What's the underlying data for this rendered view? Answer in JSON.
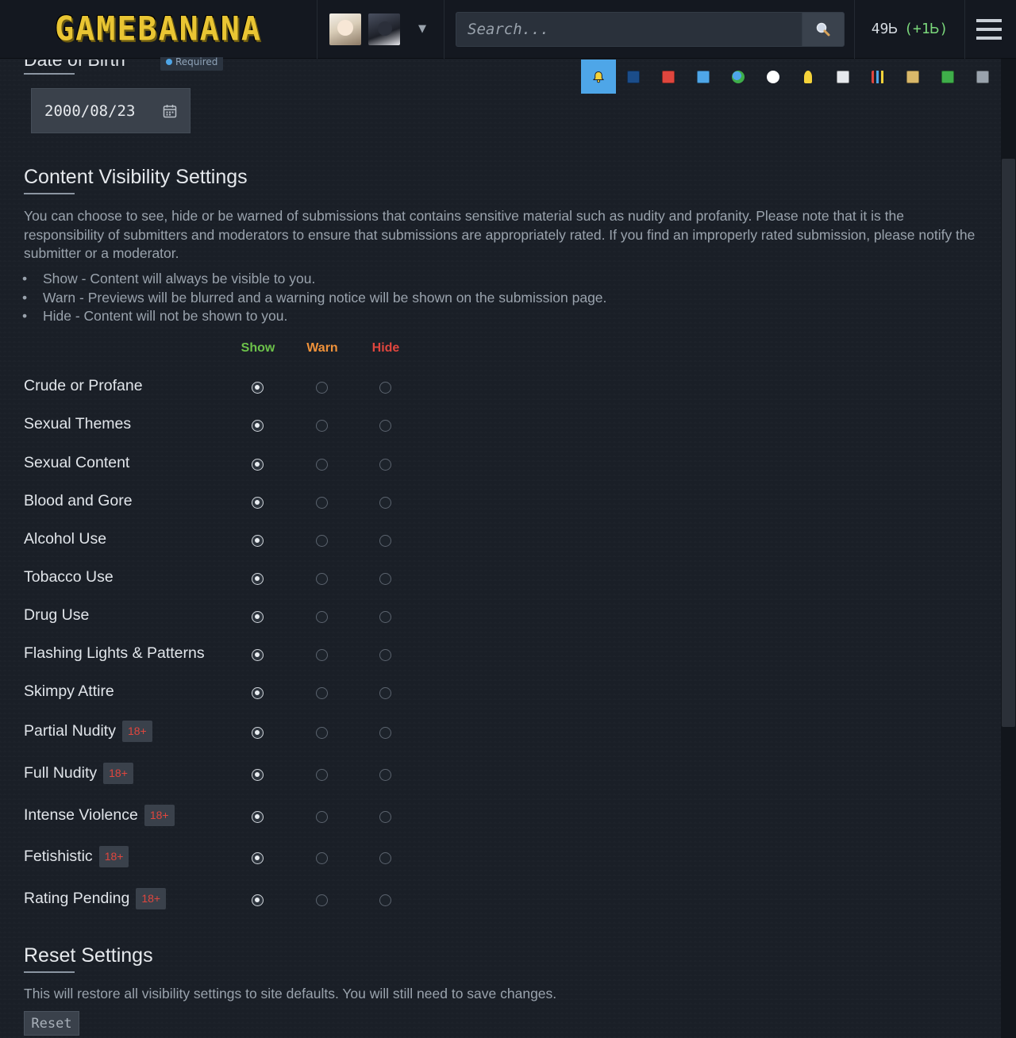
{
  "header": {
    "logo_text": "GAMEBANANA",
    "search_placeholder": "Search...",
    "points": "49Ꮟ",
    "points_delta": "(+1Ꮟ)"
  },
  "toolbar": {
    "icons": [
      "bell-icon",
      "dashboard-icon",
      "gift-icon",
      "folder-icon",
      "globe-icon",
      "dice-icon",
      "bulb-icon",
      "mail-icon",
      "stats-icon",
      "clipboard-icon",
      "inbox-icon",
      "grid-icon"
    ],
    "icon_colors": [
      "#f5d33a",
      "#1b4d8a",
      "#e0463e",
      "#4ea6e8",
      "#3fae4a",
      "#ffffff",
      "#f5d33a",
      "#e6e9ed",
      "#e0463e",
      "#d9b86a",
      "#3fae4a",
      "#9aa3ad"
    ]
  },
  "dob": {
    "title": "Date of Birth",
    "required_label": "Required",
    "value": "2000/08/23"
  },
  "visibility": {
    "title": "Content Visibility Settings",
    "description": "You can choose to see, hide or be warned of submissions that contains sensitive material such as nudity and profanity. Please note that it is the responsibility of submitters and moderators to ensure that submissions are appropriately rated. If you find an improperly rated submission, please notify the submitter or a moderator.",
    "bullets": [
      "Show - Content will always be visible to you.",
      "Warn - Previews will be blurred and a warning notice will be shown on the submission page.",
      "Hide - Content will not be shown to you."
    ],
    "columns": {
      "show": "Show",
      "warn": "Warn",
      "hide": "Hide"
    },
    "column_colors": {
      "show": "#6cc24a",
      "warn": "#f0923a",
      "hide": "#e0463e"
    },
    "badge_label": "18+",
    "rows": [
      {
        "label": "Crude or Profane",
        "badge": false,
        "selected": "show"
      },
      {
        "label": "Sexual Themes",
        "badge": false,
        "selected": "show"
      },
      {
        "label": "Sexual Content",
        "badge": false,
        "selected": "show"
      },
      {
        "label": "Blood and Gore",
        "badge": false,
        "selected": "show"
      },
      {
        "label": "Alcohol Use",
        "badge": false,
        "selected": "show"
      },
      {
        "label": "Tobacco Use",
        "badge": false,
        "selected": "show"
      },
      {
        "label": "Drug Use",
        "badge": false,
        "selected": "show"
      },
      {
        "label": "Flashing Lights & Patterns",
        "badge": false,
        "selected": "show"
      },
      {
        "label": "Skimpy Attire",
        "badge": false,
        "selected": "show"
      },
      {
        "label": "Partial Nudity",
        "badge": true,
        "selected": "show"
      },
      {
        "label": "Full Nudity",
        "badge": true,
        "selected": "show"
      },
      {
        "label": "Intense Violence",
        "badge": true,
        "selected": "show"
      },
      {
        "label": "Fetishistic",
        "badge": true,
        "selected": "show"
      },
      {
        "label": "Rating Pending",
        "badge": true,
        "selected": "show"
      }
    ]
  },
  "reset": {
    "title": "Reset Settings",
    "description": "This will restore all visibility settings to site defaults. You will still need to save changes.",
    "button_label": "Reset"
  }
}
